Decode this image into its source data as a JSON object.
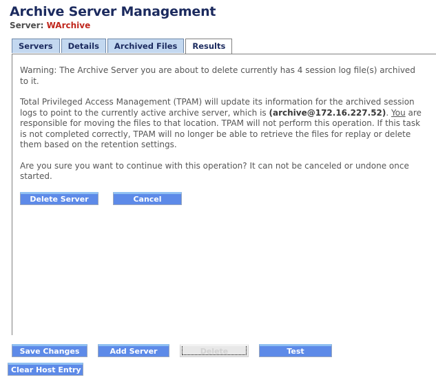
{
  "header": {
    "title": "Archive Server Management",
    "server_label": "Server:",
    "server_value": "WArchive",
    "title_color": "#1b2a5e",
    "server_value_color": "#c0271d"
  },
  "tabs": [
    {
      "label": "Servers",
      "active": false
    },
    {
      "label": "Details",
      "active": false
    },
    {
      "label": "Archived Files",
      "active": false
    },
    {
      "label": "Results",
      "active": true
    }
  ],
  "results_panel": {
    "warning": "Warning: The Archive Server you are about to delete currently has 4 session log file(s) archived to it.",
    "body": {
      "part1": "Total Privileged Access Management (TPAM) will update its information for the archived session logs to point to the currently active archive server, which is ",
      "server_bold": "(archive@172.16.227.52)",
      "part2": ". ",
      "you_underlined": "You",
      "part3": " are responsible for moving the files to that location. TPAM will not perform this operation. If this task is not completed correctly, TPAM will no longer be able to retrieve the files for replay or delete them based on the retention settings."
    },
    "confirm": "Are you sure you want to continue with this operation?  It can not be canceled or undone once started.",
    "buttons": [
      {
        "label": "Delete Server",
        "enabled": true
      },
      {
        "label": "Cancel",
        "enabled": true
      }
    ]
  },
  "bottom_toolbar": {
    "row1": [
      {
        "label": "Save Changes",
        "enabled": true
      },
      {
        "label": "Add Server",
        "enabled": true
      },
      {
        "label": "Delete",
        "enabled": false
      },
      {
        "label": "Test",
        "enabled": true
      }
    ],
    "row2": [
      {
        "label": "Clear Host Entry",
        "enabled": true
      }
    ]
  },
  "colors": {
    "button_blue": "#5d8ae8",
    "button_highlight": "#8fc0f2",
    "tab_inactive": "#c3d8f0",
    "panel_border": "#808080"
  }
}
